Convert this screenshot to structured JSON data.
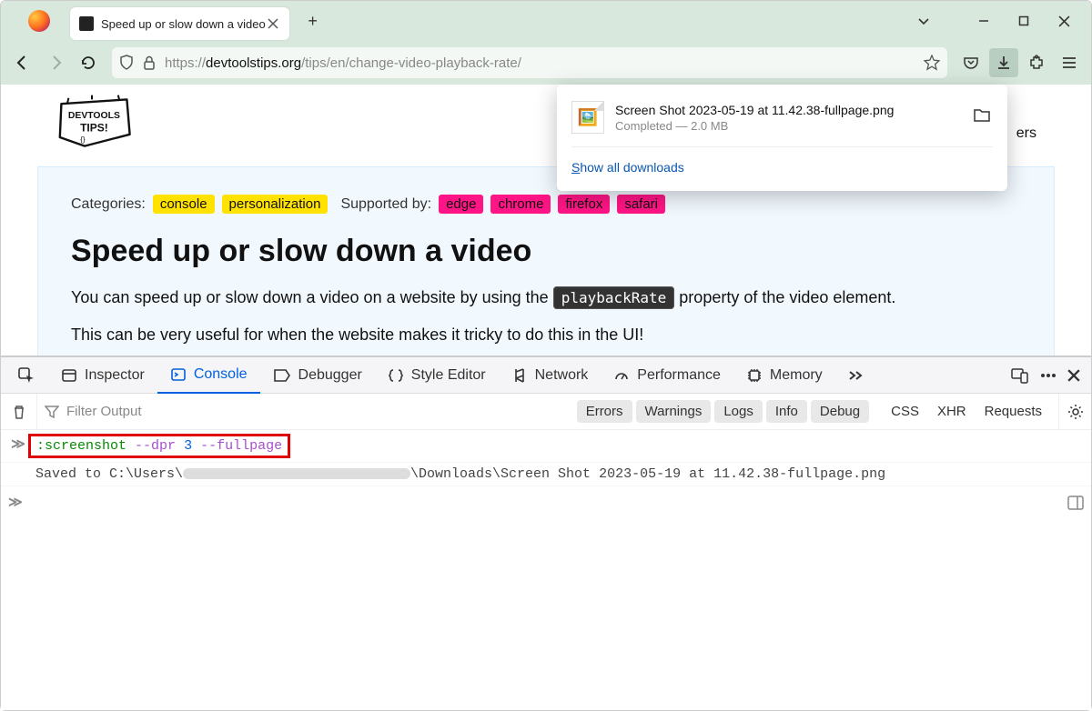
{
  "tab": {
    "title": "Speed up or slow down a video"
  },
  "url": {
    "protocol": "https://",
    "host": "devtoolstips.org",
    "path": "/tips/en/change-video-playback-rate/"
  },
  "downloads": {
    "item": {
      "name": "Screen Shot 2023-05-19 at 11.42.38-fullpage.png",
      "status": "Completed — 2.0 MB"
    },
    "show_all": "Show all downloads"
  },
  "page": {
    "logo_top": "DEVTOOLS",
    "logo_bottom": "TIPS!",
    "nav_right": "ers",
    "categories_label": "Categories:",
    "categories": [
      "console",
      "personalization"
    ],
    "supported_label": "Supported by:",
    "browsers": [
      "edge",
      "chrome",
      "firefox",
      "safari"
    ],
    "title": "Speed up or slow down a video",
    "p1_pre": "You can speed up or slow down a video on a website by using the ",
    "p1_code": "playbackRate",
    "p1_post": " property of the video element.",
    "p2": "This can be very useful for when the website makes it tricky to do this in the UI!"
  },
  "devtools": {
    "tabs": [
      "Inspector",
      "Console",
      "Debugger",
      "Style Editor",
      "Network",
      "Performance",
      "Memory"
    ],
    "filter_placeholder": "Filter Output",
    "cats": [
      "Errors",
      "Warnings",
      "Logs",
      "Info",
      "Debug"
    ],
    "ext": [
      "CSS",
      "XHR",
      "Requests"
    ],
    "cmd": {
      "name": ":screenshot",
      "f1": "--dpr",
      "n": "3",
      "f2": "--fullpage"
    },
    "out_pre": "Saved to C:\\Users\\",
    "out_post": "\\Downloads\\Screen Shot 2023-05-19 at 11.42.38-fullpage.png"
  }
}
